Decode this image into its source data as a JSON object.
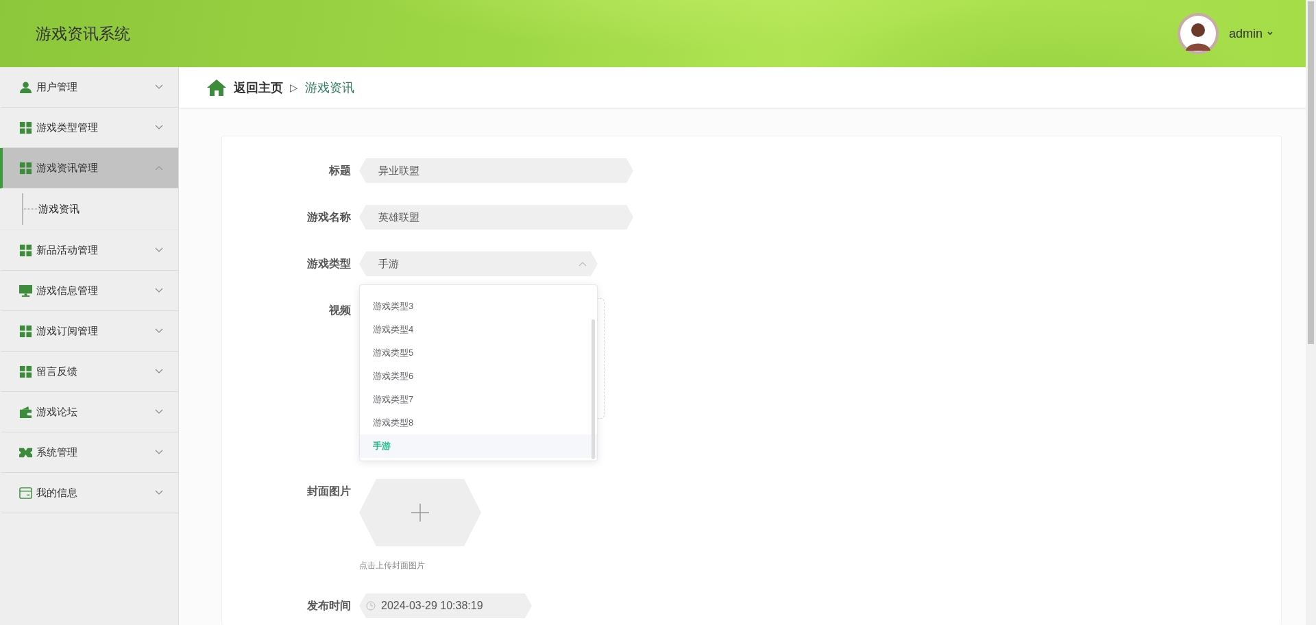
{
  "header": {
    "title": "游戏资讯系统",
    "user": "admin"
  },
  "sidebar": {
    "items": [
      {
        "label": "用户管理",
        "kind": "user",
        "expanded": false,
        "selected": false
      },
      {
        "label": "游戏类型管理",
        "kind": "grid",
        "expanded": false,
        "selected": false
      },
      {
        "label": "游戏资讯管理",
        "kind": "grid",
        "expanded": true,
        "selected": true,
        "children": [
          {
            "label": "游戏资讯"
          }
        ]
      },
      {
        "label": "新品活动管理",
        "kind": "grid",
        "expanded": false,
        "selected": false
      },
      {
        "label": "游戏信息管理",
        "kind": "monitor",
        "expanded": false,
        "selected": false
      },
      {
        "label": "游戏订阅管理",
        "kind": "grid",
        "expanded": false,
        "selected": false
      },
      {
        "label": "留言反馈",
        "kind": "grid",
        "expanded": false,
        "selected": false
      },
      {
        "label": "游戏论坛",
        "kind": "wallet",
        "expanded": false,
        "selected": false
      },
      {
        "label": "系统管理",
        "kind": "ticket",
        "expanded": false,
        "selected": false
      },
      {
        "label": "我的信息",
        "kind": "card",
        "expanded": false,
        "selected": false
      }
    ]
  },
  "breadcrumb": {
    "home": "返回主页",
    "separator": "▷",
    "current": "游戏资讯"
  },
  "form": {
    "fields": [
      {
        "kind": "text",
        "label": "标题",
        "value": "异业联盟"
      },
      {
        "kind": "text",
        "label": "游戏名称",
        "value": "英雄联盟"
      },
      {
        "kind": "select",
        "label": "游戏类型",
        "value": "手游",
        "expanded": true,
        "options": [
          {
            "label": "游戏类型3",
            "selected": false
          },
          {
            "label": "游戏类型4",
            "selected": false
          },
          {
            "label": "游戏类型5",
            "selected": false
          },
          {
            "label": "游戏类型6",
            "selected": false
          },
          {
            "label": "游戏类型7",
            "selected": false
          },
          {
            "label": "游戏类型8",
            "selected": false
          },
          {
            "label": "手游",
            "selected": true
          }
        ]
      },
      {
        "kind": "video",
        "label": "视频"
      },
      {
        "kind": "image",
        "label": "封面图片",
        "hint": "点击上传封面图片"
      },
      {
        "kind": "datetime",
        "label": "发布时间",
        "value": "2024-03-29 10:38:19"
      }
    ]
  }
}
